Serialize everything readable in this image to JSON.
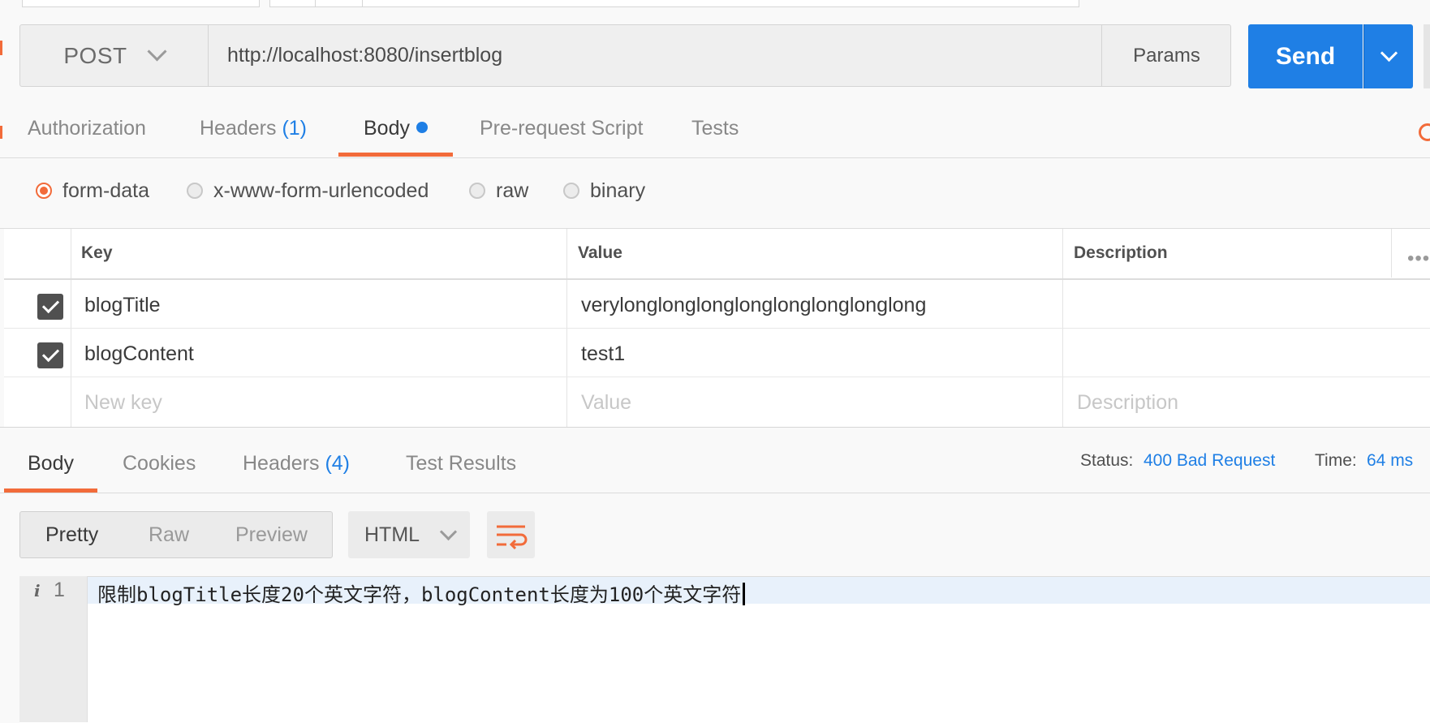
{
  "request": {
    "method": "POST",
    "url": "http://localhost:8080/insertblog",
    "params_label": "Params",
    "send_label": "Send"
  },
  "request_tabs": [
    {
      "label": "Authorization",
      "count": ""
    },
    {
      "label": "Headers",
      "count": "(1)"
    },
    {
      "label": "Body",
      "count": ""
    },
    {
      "label": "Pre-request Script",
      "count": ""
    },
    {
      "label": "Tests",
      "count": ""
    }
  ],
  "body_types": [
    {
      "label": "form-data",
      "checked": true
    },
    {
      "label": "x-www-form-urlencoded",
      "checked": false
    },
    {
      "label": "raw",
      "checked": false
    },
    {
      "label": "binary",
      "checked": false
    }
  ],
  "form_table": {
    "headers": [
      "Key",
      "Value",
      "Description"
    ],
    "rows": [
      {
        "enabled": true,
        "key": "blogTitle",
        "value": "verylonglonglonglonglonglonglonglong",
        "description": ""
      },
      {
        "enabled": true,
        "key": "blogContent",
        "value": "test1",
        "description": ""
      }
    ],
    "placeholders": {
      "key": "New key",
      "value": "Value",
      "description": "Description"
    }
  },
  "response_tabs": [
    {
      "label": "Body",
      "count": ""
    },
    {
      "label": "Cookies",
      "count": ""
    },
    {
      "label": "Headers",
      "count": "(4)"
    },
    {
      "label": "Test Results",
      "count": ""
    }
  ],
  "response_status": {
    "status_label": "Status:",
    "status_value": "400 Bad Request",
    "time_label": "Time:",
    "time_value": "64 ms"
  },
  "view_modes": [
    "Pretty",
    "Raw",
    "Preview"
  ],
  "format": "HTML",
  "editor": {
    "line_number": "1",
    "info_glyph": "i",
    "content": "限制blogTitle长度20个英文字符，blogContent长度为100个英文字符"
  },
  "colors": {
    "accent_orange": "#f26b3a",
    "send_blue": "#1f7fe5",
    "status_blue": "#1f7fe5"
  }
}
